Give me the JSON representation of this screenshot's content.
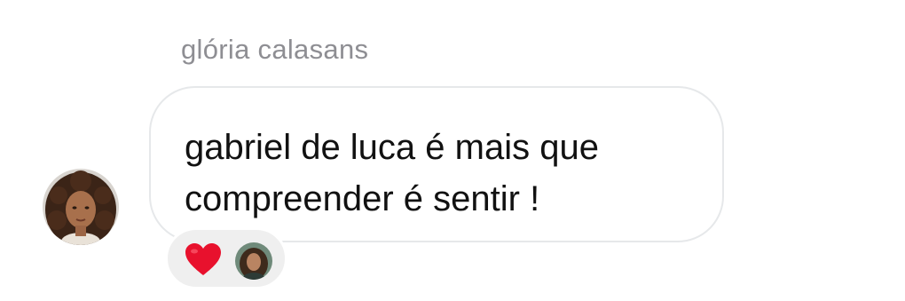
{
  "sender": {
    "name": "glória calasans"
  },
  "message": {
    "text": "gabriel de luca é mais que\ncompreender é sentir !"
  },
  "reactions": {
    "emoji": "heart",
    "icons": [
      "heart-icon",
      "avatar"
    ]
  },
  "colors": {
    "bubble_border": "#e6e8ea",
    "sender_text": "#8e8e93",
    "heart": "#e8112d",
    "reaction_bg": "#efefef"
  }
}
